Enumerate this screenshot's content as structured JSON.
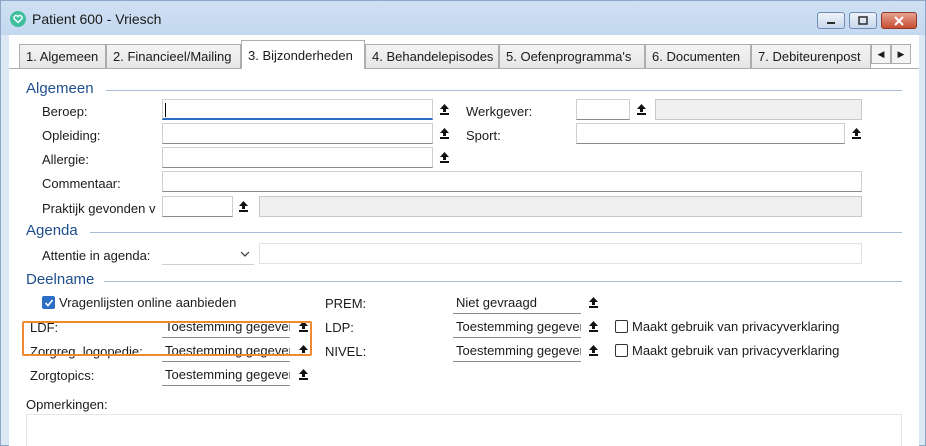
{
  "window": {
    "title": "Patient 600 - Vriesch"
  },
  "tabs": [
    "1. Algemeen",
    "2. Financieel/Mailing",
    "3. Bijzonderheden",
    "4. Behandelepisodes",
    "5. Oefenprogramma's",
    "6. Documenten",
    "7. Debiteurenpost"
  ],
  "active_tab_index": 2,
  "algemeen": {
    "title": "Algemeen",
    "beroep_label": "Beroep:",
    "beroep_value": "",
    "opleiding_label": "Opleiding:",
    "opleiding_value": "",
    "allergie_label": "Allergie:",
    "allergie_value": "",
    "commentaar_label": "Commentaar:",
    "commentaar_value": "",
    "praktijk_label": "Praktijk gevonden v",
    "praktijk_value": "",
    "werkgever_label": "Werkgever:",
    "werkgever_value": "",
    "sport_label": "Sport:",
    "sport_value": ""
  },
  "agenda": {
    "title": "Agenda",
    "attentie_label": "Attentie in agenda:",
    "attentie_value": ""
  },
  "deelname": {
    "title": "Deelname",
    "vragenlijsten_label": "Vragenlijsten online aanbieden",
    "vragenlijsten_checked": true,
    "ldf_label": "LDF:",
    "ldf_value": "Toestemming gegeven",
    "zorgreg_label": "Zorgreg. logopedie:",
    "zorgreg_value": "Toestemming gegeven",
    "zorgtopics_label": "Zorgtopics:",
    "zorgtopics_value": "Toestemming gegeven",
    "prem_label": "PREM:",
    "prem_value": "Niet gevraagd",
    "ldp_label": "LDP:",
    "ldp_value": "Toestemming gegeven",
    "nivel_label": "NIVEL:",
    "nivel_value": "Toestemming gegeven",
    "privacy1_label": "Maakt gebruik van privacyverklaring",
    "privacy1_checked": false,
    "privacy2_label": "Maakt gebruik van privacyverklaring",
    "privacy2_checked": false
  },
  "opmerkingen_label": "Opmerkingen:",
  "colors": {
    "accent": "#2b6cc4",
    "section_title": "#1f4e8c",
    "highlight": "#f08a30"
  },
  "icons": [
    "app-heart-icon",
    "minimize-icon",
    "maximize-icon",
    "close-icon",
    "pick-list-icon",
    "chevron-down-icon",
    "checkmark-icon"
  ]
}
